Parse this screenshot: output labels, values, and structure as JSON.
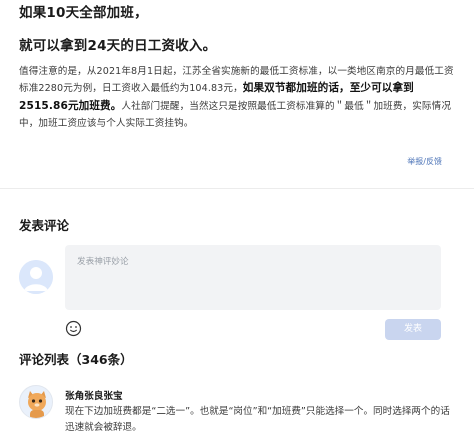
{
  "article": {
    "headline_1": "如果10天全部加班，",
    "headline_2": "就可以拿到24天的日工资收入。",
    "para_normal_1": "值得注意的是，从2021年8月1日起，江苏全省实施新的最低工资标准，以一类地区南京的月最低工资标准2280元为例，日工资收入最低约为104.83元，",
    "para_bold": "如果双节都加班的话，至少可以拿到2515.86元加班费。",
    "para_normal_2": "人社部门提醒，当然这只是按照最低工资标准算的＂最低＂加班费，实际情况中，加班工资应该与个人实际工资挂钩。",
    "report_link": "举报/反馈"
  },
  "comments": {
    "section_title": "发表评论",
    "input_placeholder": "发表神评妙论",
    "submit_label": "发表",
    "list_title": "评论列表（346条）",
    "items": [
      {
        "user": "张角张良张宝",
        "text": "现在下边加班费都是“二选一”。也就是“岗位”和“加班费”只能选择一个。同时选择两个的话迅速就会被辞退。"
      }
    ]
  },
  "colors": {
    "link": "#4b73b7",
    "submit_bg": "#c9d5ef",
    "input_bg": "#f2f3f5"
  }
}
